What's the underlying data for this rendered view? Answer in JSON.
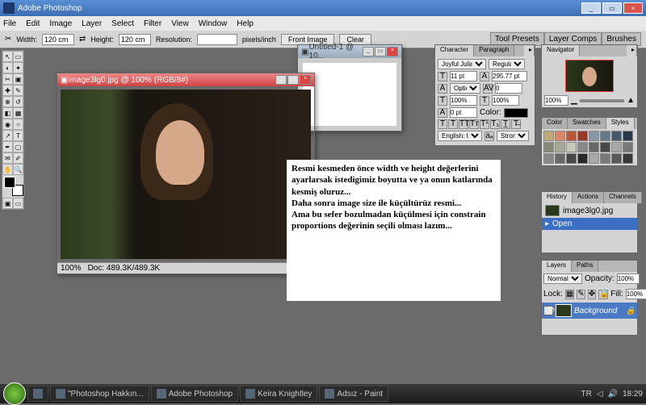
{
  "app": {
    "title": "Adobe Photoshop"
  },
  "menu": [
    "File",
    "Edit",
    "Image",
    "Layer",
    "Select",
    "Filter",
    "View",
    "Window",
    "Help"
  ],
  "options": {
    "width_label": "Width:",
    "width_value": "120 cm",
    "height_label": "Height:",
    "height_value": "120 cm",
    "res_label": "Resolution:",
    "res_unit": "pixels/inch",
    "front_btn": "Front Image",
    "clear_btn": "Clear",
    "tabs": [
      "Tool Presets",
      "Layer Comps",
      "Brushes"
    ]
  },
  "doc_main": {
    "title": "image3lg0.jpg @ 100% (RGB/8#)",
    "zoom": "100%",
    "docsize": "Doc: 489.3K/489.3K"
  },
  "doc_sub": {
    "title": "Untitled-1 @ 10..."
  },
  "note_text": "Resmi kesmeden önce width ve height değerlerini ayarlarsak istedigimiz boyutta ve ya onun katlarında kesmiş oluruz...\nDaha sonra image size ile küçültürüz resmi...\nAma bu sefer bozulmadan küçülmesi için constrain proportions değerinin seçili olması lazım...",
  "character": {
    "tab1": "Character",
    "tab2": "Paragraph",
    "font": "Joyful Juliana",
    "style": "Regular",
    "size": "11 pt",
    "leading": "295.77 pt",
    "optical": "Optical",
    "tracking": "0",
    "vscale": "100%",
    "hscale": "100%",
    "baseline": "0 pt",
    "color_label": "Color:",
    "lang": "English: USA",
    "aa": "Strong"
  },
  "navigator": {
    "tab": "Navigator",
    "zoom": "100%"
  },
  "colorpanel": {
    "tabs": [
      "Color",
      "Swatches",
      "Styles"
    ]
  },
  "history": {
    "tabs": [
      "History",
      "Actions",
      "Channels"
    ],
    "snap": "image3lg0.jpg",
    "step": "Open"
  },
  "layers": {
    "tabs": [
      "Layers",
      "Paths"
    ],
    "mode": "Normal",
    "opacity_label": "Opacity:",
    "opacity": "100%",
    "lock": "Lock:",
    "fill": "100%",
    "bg": "Background"
  },
  "taskbar": {
    "items": [
      "\"Photoshop Hakkın...",
      "Adobe Photoshop",
      "Keira Knightley",
      "Adsız - Paint"
    ],
    "lang": "TR",
    "time": "18:29"
  },
  "swatch_colors": [
    "#c0a878",
    "#d88868",
    "#b85838",
    "#983828",
    "#8898a8",
    "#687888",
    "#485868",
    "#283848",
    "#888878",
    "#a8a898",
    "#c8c8b8",
    "#888888",
    "#686868",
    "#484848",
    "#a8a8a8",
    "#787878",
    "#888888",
    "#686868",
    "#484848",
    "#282828",
    "#a8a8a8",
    "#787878",
    "#585858",
    "#383838"
  ]
}
